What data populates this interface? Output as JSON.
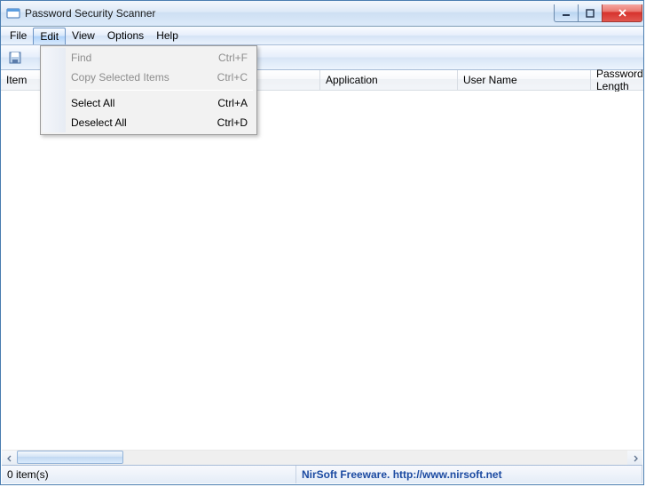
{
  "window": {
    "title": "Password Security Scanner"
  },
  "menubar": {
    "items": [
      {
        "label": "File"
      },
      {
        "label": "Edit"
      },
      {
        "label": "View"
      },
      {
        "label": "Options"
      },
      {
        "label": "Help"
      }
    ]
  },
  "edit_menu": {
    "items": [
      {
        "label": "Find",
        "shortcut": "Ctrl+F",
        "enabled": false
      },
      {
        "label": "Copy Selected Items",
        "shortcut": "Ctrl+C",
        "enabled": false
      },
      {
        "label": "Select All",
        "shortcut": "Ctrl+A",
        "enabled": true
      },
      {
        "label": "Deselect All",
        "shortcut": "Ctrl+D",
        "enabled": true
      }
    ]
  },
  "columns": {
    "item": "Item",
    "application": "Application",
    "user_name": "User Name",
    "password_length": "Password Length"
  },
  "statusbar": {
    "count": "0 item(s)",
    "credit": "NirSoft Freeware.  http://www.nirsoft.net"
  }
}
